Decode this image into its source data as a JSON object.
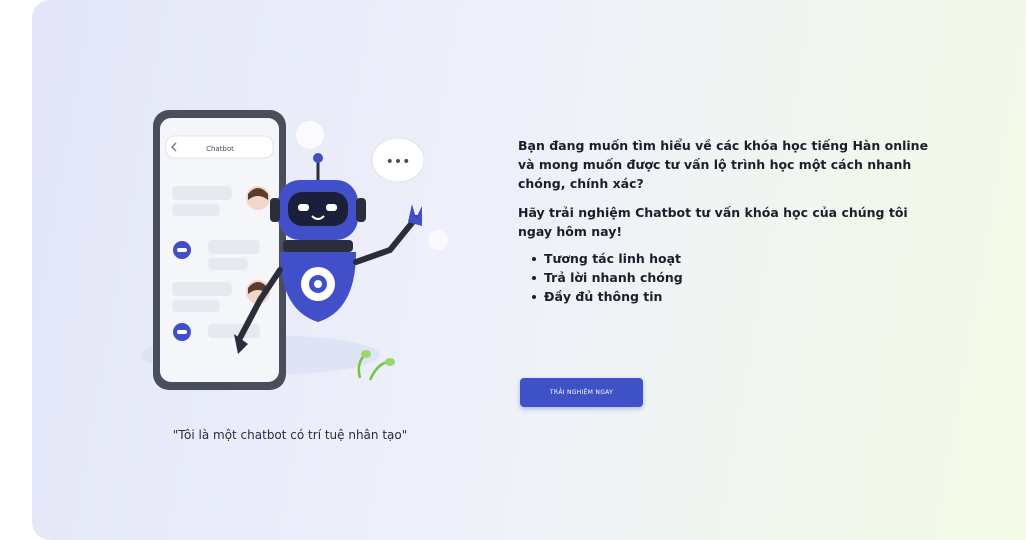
{
  "illustration": {
    "phone_header_label": "Chatbot",
    "typing_bubble": "•••",
    "caption": "\"Tôi là một chatbot có trí tuệ nhân tạo\""
  },
  "promo": {
    "intro": "Bạn đang muốn tìm hiểu về các khóa học tiếng Hàn online và mong muốn được tư vấn lộ trình học một cách nhanh chóng, chính xác?",
    "invite": "Hãy trải nghiệm Chatbot tư vấn khóa học của chúng tôi ngay hôm nay!",
    "bullets": [
      "Tương tác linh hoạt",
      "Trả lời nhanh chóng",
      "Đầy đủ thông tin"
    ]
  },
  "cta": {
    "label": "Trải nghiệm ngay"
  },
  "colors": {
    "accent": "#3f51c6",
    "robot_blue": "#4150c9",
    "phone_frame": "#4a4d5c",
    "text": "#1c1f2b"
  }
}
